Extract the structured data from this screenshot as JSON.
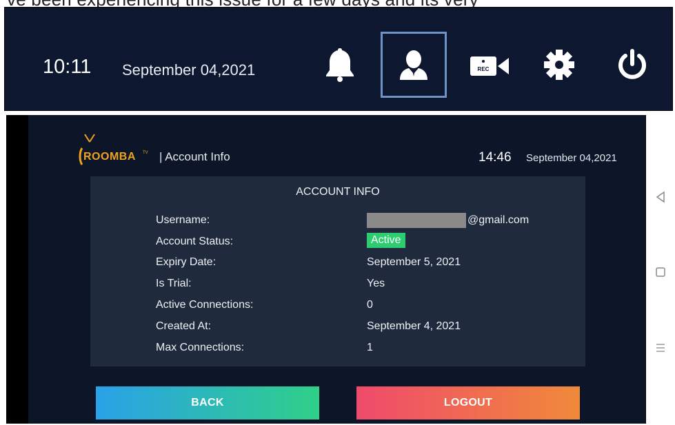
{
  "top_crop_text": "ve been experiencing this issue for a few days and its very",
  "topbar": {
    "time": "10:11",
    "date": "September 04,2021",
    "icons": [
      "bell-icon",
      "user-icon",
      "rec-camera-icon",
      "gear-icon",
      "power-icon"
    ],
    "rec_label": "REC",
    "selected": "user-icon"
  },
  "app": {
    "logo_text": "ROOMBA",
    "logo_tm": "TV",
    "section_title": "| Account Info",
    "time": "14:46",
    "date": "September 04,2021"
  },
  "account": {
    "title": "ACCOUNT INFO",
    "username_label": "Username:",
    "username_value": "@gmail.com",
    "status_label": "Account Status:",
    "status_value": "Active",
    "expiry_label": "Expiry Date:",
    "expiry_value": "September 5, 2021",
    "trial_label": "Is Trial:",
    "trial_value": "Yes",
    "active_conn_label": "Active Connections:",
    "active_conn_value": "0",
    "created_label": "Created At:",
    "created_value": "September 4, 2021",
    "max_conn_label": "Max Connections:",
    "max_conn_value": "1"
  },
  "buttons": {
    "back": "BACK",
    "logout": "LOGOUT"
  },
  "colors": {
    "topbar_bg": "#0d1730",
    "screen_bg": "#0c1628",
    "card_bg": "#1f2a3d",
    "active_badge": "#2ecc71",
    "selected_border": "#6f93c4",
    "logo": "#f0a21f"
  }
}
